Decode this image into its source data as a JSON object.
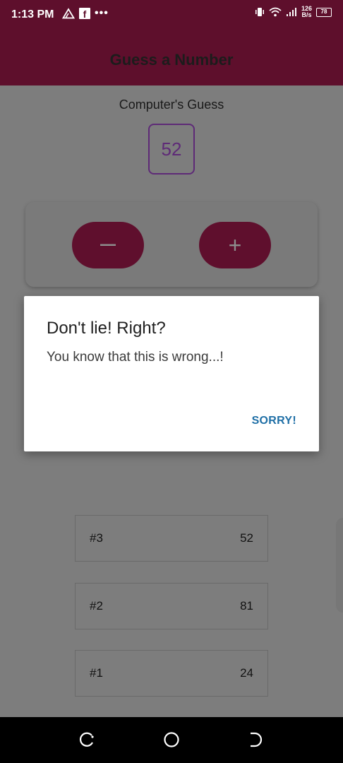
{
  "status_bar": {
    "time": "1:13 PM",
    "icons": [
      "warning-triangle-icon",
      "facebook-icon",
      "more-dots-icon"
    ],
    "net_speed_top": "126",
    "net_speed_bottom": "B/s",
    "battery_level": "78"
  },
  "header": {
    "title": "Guess a Number",
    "color": "#5e0f2c"
  },
  "game": {
    "label": "Computer's Guess",
    "current_guess": "52",
    "minus_label": "—",
    "plus_label": "+"
  },
  "dialog": {
    "title": "Don't lie! Right?",
    "message": "You know that this is wrong...!",
    "action_label": "SORRY!",
    "action_color": "#1f6fa6"
  },
  "guesses": [
    {
      "round": "#3",
      "value": "52"
    },
    {
      "round": "#2",
      "value": "81"
    },
    {
      "round": "#1",
      "value": "24"
    }
  ],
  "nav_bar": {
    "icons": [
      "back-icon",
      "home-icon",
      "recent-apps-icon"
    ]
  }
}
